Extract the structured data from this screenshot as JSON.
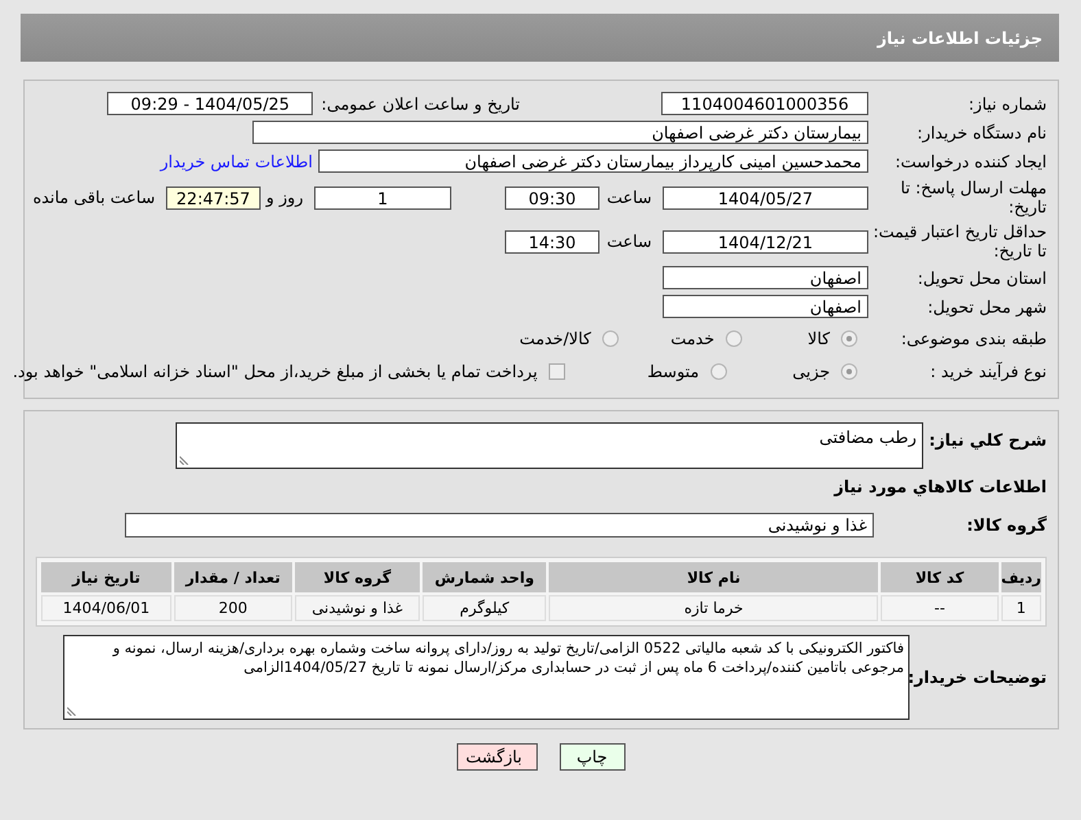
{
  "header": {
    "title": "جزئیات اطلاعات نیاز"
  },
  "need_number": {
    "label": "شماره نیاز:",
    "value": "1104004601000356"
  },
  "announce_datetime": {
    "label": "تاریخ و ساعت اعلان عمومی:",
    "value": "1404/05/25 - 09:29"
  },
  "buyer_org": {
    "label": "نام دستگاه خریدار:",
    "value": "بیمارستان دکتر غرضی اصفهان"
  },
  "requester": {
    "label": "ایجاد کننده درخواست:",
    "value": "محمدحسین امینی کارپرداز بیمارستان دکتر غرضی اصفهان",
    "link": "اطلاعات تماس خریدار"
  },
  "reply_deadline": {
    "label": "مهلت ارسال پاسخ: تا تاریخ:",
    "date": "1404/05/27",
    "time_label": "ساعت",
    "time": "09:30",
    "days": "1",
    "days_label": "روز و",
    "remaining": "22:47:57",
    "remaining_label": "ساعت باقی مانده"
  },
  "price_validity": {
    "label": "حداقل تاریخ اعتبار قیمت: تا تاریخ:",
    "date": "1404/12/21",
    "time_label": "ساعت",
    "time": "14:30"
  },
  "province": {
    "label": "استان محل تحویل:",
    "value": "اصفهان"
  },
  "city": {
    "label": "شهر محل تحویل:",
    "value": "اصفهان"
  },
  "category": {
    "label": "طبقه بندی موضوعی:",
    "options": [
      {
        "label": "کالا",
        "selected": true
      },
      {
        "label": "خدمت",
        "selected": false
      },
      {
        "label": "کالا/خدمت",
        "selected": false
      }
    ]
  },
  "purchase_type": {
    "label": "نوع فرآیند خرید :",
    "options": [
      {
        "label": "جزیی",
        "selected": true
      },
      {
        "label": "متوسط",
        "selected": false
      }
    ],
    "payment_note": {
      "text": "پرداخت تمام یا بخشی از مبلغ خرید،از محل \"اسناد خزانه اسلامی\" خواهد بود.",
      "checked": false
    }
  },
  "description": {
    "label": "شرح كلي نياز:",
    "value": "رطب مضافتی"
  },
  "goods_header": "اطلاعات كالاهاي مورد نياز",
  "goods_group": {
    "label": "گروه کالا:",
    "value": "غذا و نوشیدنی"
  },
  "table": {
    "columns": [
      "ردیف",
      "کد کالا",
      "نام کالا",
      "واحد شمارش",
      "گروه کالا",
      "تعداد / مقدار",
      "تاریخ نیاز"
    ],
    "rows": [
      [
        "1",
        "--",
        "خرما تازه",
        "کیلوگرم",
        "غذا و نوشیدنی",
        "200",
        "1404/06/01"
      ]
    ]
  },
  "buyer_notes": {
    "label": "توضیحات خریدار:",
    "value": "فاکتور الکترونیکی با کد شعبه مالیاتی 0522 الزامی/تاریخ تولید به روز/دارای پروانه ساخت وشماره بهره برداری/هزینه ارسال، نمونه و مرجوعی باتامین کننده/پرداخت 6 ماه پس از ثبت در حسابداری مرکز/ارسال نمونه تا تاریخ 1404/05/27الزامی"
  },
  "buttons": [
    {
      "label": "چاپ",
      "kind": "print"
    },
    {
      "label": "بازگشت",
      "kind": "back"
    }
  ]
}
